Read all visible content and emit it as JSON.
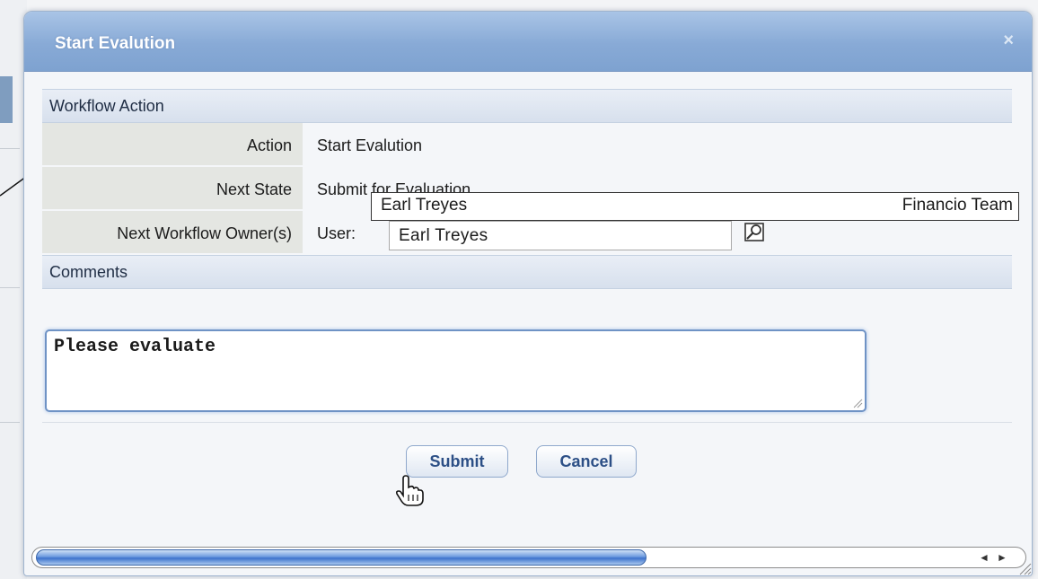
{
  "dialog": {
    "title": "Start Evalution",
    "close_symbol": "×"
  },
  "workflow_action": {
    "header": "Workflow Action",
    "action_label": "Action",
    "action_value": "Start Evalution",
    "next_state_label": "Next State",
    "next_state_value": "Submit for Evaluation",
    "owner_label": "Next Workflow Owner(s)",
    "user_label": "User:",
    "user_value": "Earl Treyes",
    "lookup_icon": "lookup-icon"
  },
  "autocomplete": {
    "name": "Earl Treyes",
    "team": "Financio Team"
  },
  "comments": {
    "header": "Comments",
    "text": "Please evaluate"
  },
  "buttons": {
    "submit": "Submit",
    "cancel": "Cancel"
  },
  "scrollbar": {
    "left_arrow": "◄",
    "right_arrow": "►"
  },
  "colors": {
    "title_bar": "#88aad6",
    "button_text": "#2c4f86"
  }
}
